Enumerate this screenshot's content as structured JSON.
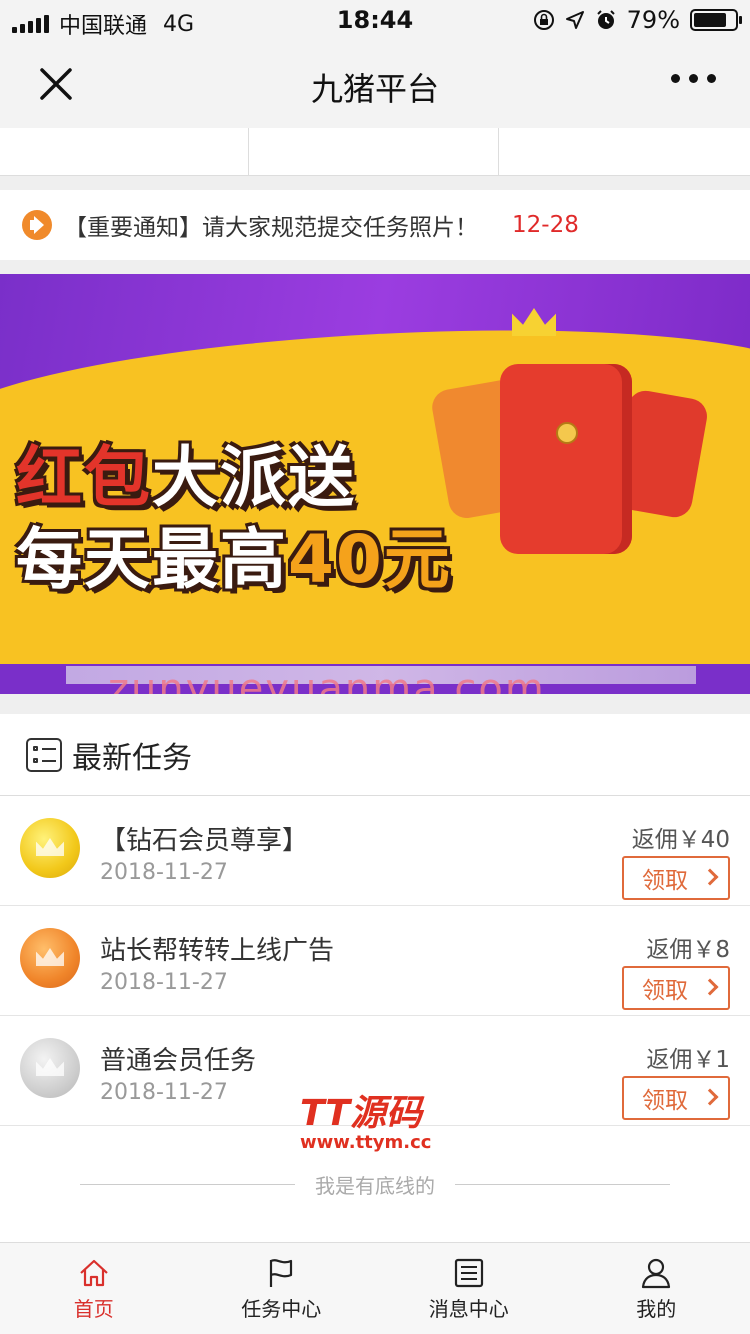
{
  "status_bar": {
    "carrier": "中国联通",
    "network": "4G",
    "time": "18:44",
    "battery": "79%",
    "battery_level": 0.79
  },
  "nav": {
    "title": "九猪平台"
  },
  "notice": {
    "text": "【重要通知】请大家规范提交任务照片！",
    "date": "12-28"
  },
  "banner": {
    "line1_part1": "红包",
    "line1_part2": "大派送",
    "line2_part1": "每天最高",
    "line2_part2": "40元",
    "watermark": "zunyueyuanma.com"
  },
  "section": {
    "title": "最新任务"
  },
  "tasks": [
    {
      "title": "【钻石会员尊享】",
      "date": "2018-11-27",
      "reward": "返佣￥40",
      "button": "领取",
      "medal": "gold-crown-medal-icon"
    },
    {
      "title": "站长帮转转上线广告",
      "date": "2018-11-27",
      "reward": "返佣￥8",
      "button": "领取",
      "medal": "orange-crown-medal-icon"
    },
    {
      "title": "普通会员任务",
      "date": "2018-11-27",
      "reward": "返佣￥1",
      "button": "领取",
      "medal": "silver-crown-medal-icon"
    }
  ],
  "footer_note": "我是有底线的",
  "watermark2": {
    "line1": "TT源码",
    "line2": "www.ttym.cc"
  },
  "tabbar": [
    {
      "label": "首页",
      "icon": "home-icon",
      "active": true
    },
    {
      "label": "任务中心",
      "icon": "flag-icon",
      "active": false
    },
    {
      "label": "消息中心",
      "icon": "message-list-icon",
      "active": false
    },
    {
      "label": "我的",
      "icon": "user-icon",
      "active": false
    }
  ],
  "colors": {
    "accent_red": "#d9302c",
    "button_orange": "#e06a3b",
    "notice_icon": "#f08a2b"
  }
}
